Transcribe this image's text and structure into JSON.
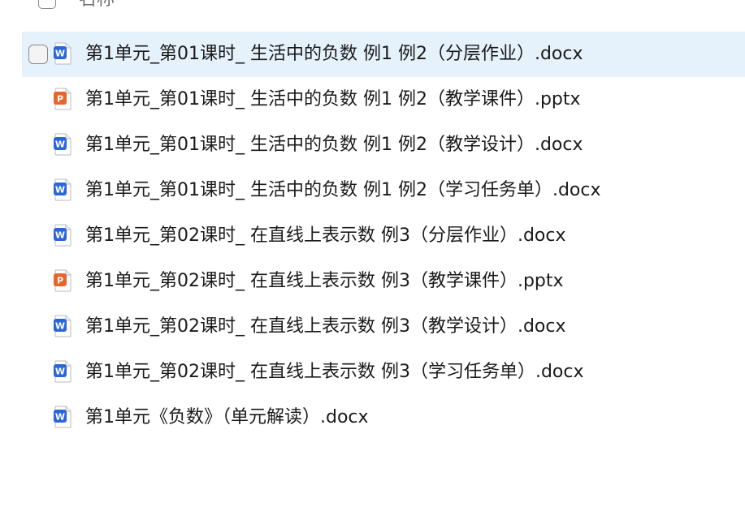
{
  "header": {
    "name_column_label": "名称"
  },
  "colors": {
    "selected_row_bg": "#e5f1fb",
    "word_icon": "#2b66d9",
    "ppt_icon": "#e8642a"
  },
  "files": [
    {
      "name": "第1单元_第01课时_ 生活中的负数  例1 例2（分层作业）.docx",
      "type": "docx",
      "icon": "word-icon",
      "selected": true
    },
    {
      "name": "第1单元_第01课时_ 生活中的负数  例1 例2（教学课件）.pptx",
      "type": "pptx",
      "icon": "powerpoint-icon",
      "selected": false
    },
    {
      "name": "第1单元_第01课时_ 生活中的负数  例1 例2（教学设计）.docx",
      "type": "docx",
      "icon": "word-icon",
      "selected": false
    },
    {
      "name": "第1单元_第01课时_ 生活中的负数  例1 例2（学习任务单）.docx",
      "type": "docx",
      "icon": "word-icon",
      "selected": false
    },
    {
      "name": "第1单元_第02课时_ 在直线上表示数  例3（分层作业）.docx",
      "type": "docx",
      "icon": "word-icon",
      "selected": false
    },
    {
      "name": "第1单元_第02课时_ 在直线上表示数  例3（教学课件）.pptx",
      "type": "pptx",
      "icon": "powerpoint-icon",
      "selected": false
    },
    {
      "name": "第1单元_第02课时_ 在直线上表示数  例3（教学设计）.docx",
      "type": "docx",
      "icon": "word-icon",
      "selected": false
    },
    {
      "name": "第1单元_第02课时_ 在直线上表示数  例3（学习任务单）.docx",
      "type": "docx",
      "icon": "word-icon",
      "selected": false
    },
    {
      "name": "第1单元《负数》（单元解读）.docx",
      "type": "docx",
      "icon": "word-icon",
      "selected": false
    }
  ]
}
